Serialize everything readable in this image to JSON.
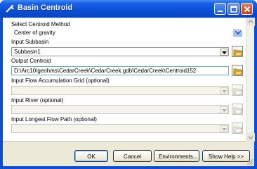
{
  "window": {
    "title": "Basin Centroid"
  },
  "form": {
    "centroid_method": {
      "label": "Select Centroid Method",
      "value": "Center of gravity"
    },
    "input_subbasin": {
      "label": "Input Subbasin",
      "value": "Subbasin1"
    },
    "output_centroid": {
      "label": "Output Centroid",
      "value": "D:\\Arc10\\geohms\\CedarCreek\\CedarCreek.gdb\\CedarCreek\\Centroid152"
    },
    "flow_accumulation": {
      "label": "Input Flow Accumulation Grid (optional)",
      "value": ""
    },
    "input_river": {
      "label": "Input River (optional)",
      "value": ""
    },
    "longest_flow_path": {
      "label": "Input Longest Flow Path (optional)",
      "value": ""
    }
  },
  "buttons": {
    "ok": "OK",
    "cancel": "Cancel",
    "environments": "Environments...",
    "show_help": "Show Help >>"
  },
  "colors": {
    "titlebar": "#0a4fd8",
    "dialog_bg": "#ece9d8",
    "panel_bg": "#ffffff",
    "field_border": "#7f9db9"
  },
  "icons": {
    "title": "tool-icon",
    "browse": "folder-open-icon",
    "dropdown": "chevron-down-icon"
  }
}
